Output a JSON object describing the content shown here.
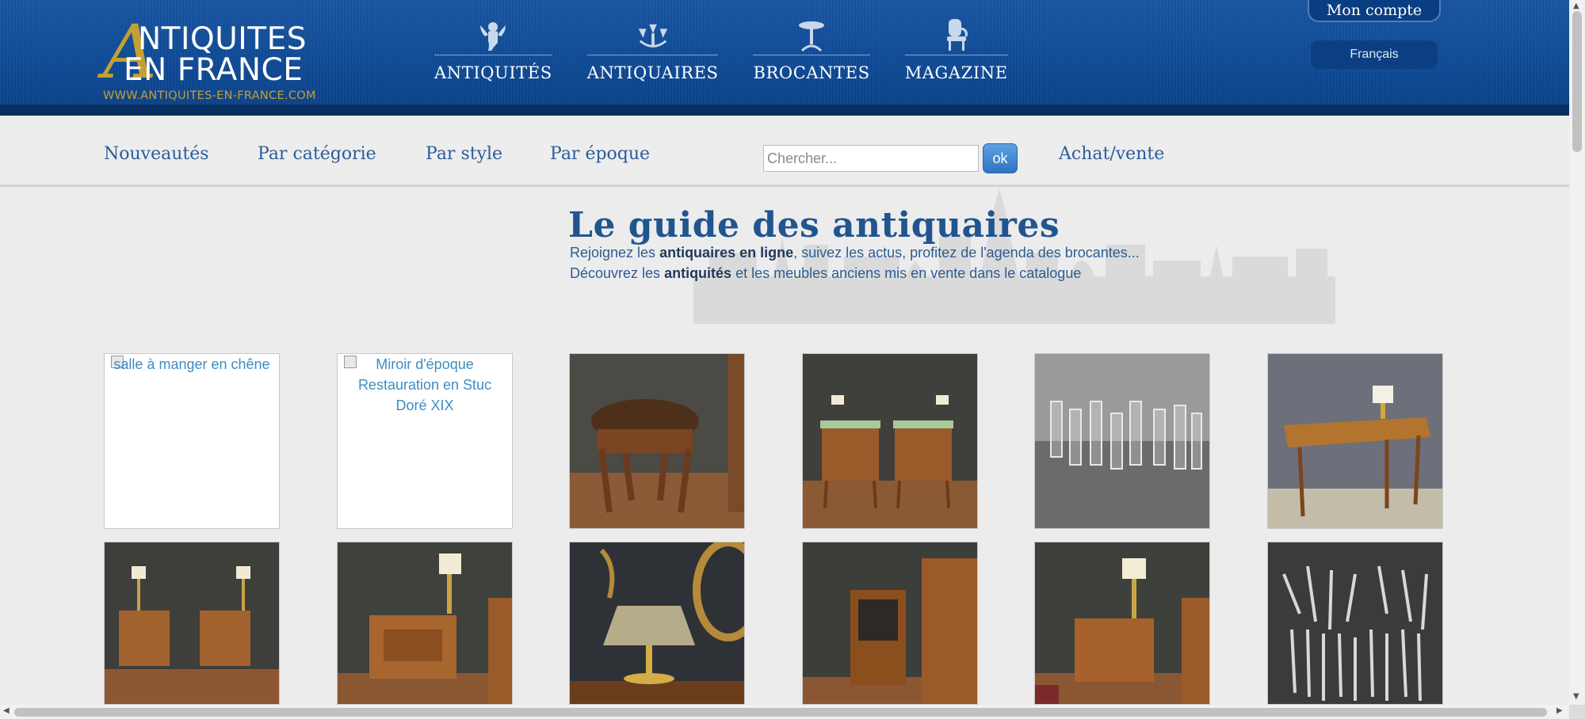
{
  "logo": {
    "letter": "A",
    "line1": "NTIQUITES",
    "line2": "EN FRANCE",
    "url": "WWW.ANTIQUITES-EN-FRANCE.COM"
  },
  "mainnav": [
    {
      "label": "ANTIQUITÉS",
      "icon": "cherub-icon"
    },
    {
      "label": "ANTIQUAIRES",
      "icon": "chandelier-icon"
    },
    {
      "label": "BROCANTES",
      "icon": "table-icon"
    },
    {
      "label": "MAGAZINE",
      "icon": "chair-icon"
    }
  ],
  "account": {
    "label": "Mon compte",
    "language": "Français"
  },
  "subnav": {
    "items": [
      "Nouveautés",
      "Par catégorie",
      "Par style",
      "Par époque"
    ],
    "search_placeholder": "Chercher...",
    "ok_label": "ok",
    "achat": "Achat/vente"
  },
  "guide": {
    "title": "Le guide des antiquaires",
    "line1_pre": "Rejoignez les ",
    "line1_bold": "antiquaires en ligne",
    "line1_post": ", suivez les actus, profitez de l'agenda des brocantes...",
    "line2_pre": "Découvrez les ",
    "line2_bold": "antiquités",
    "line2_post": " et les meubles anciens mis en vente dans le catalogue"
  },
  "thumbnails": {
    "broken1_alt": "salle à manger en chêne",
    "broken2_alt": "Miroir d'époque Restauration en Stuc Doré XIX"
  },
  "colors": {
    "header_blue": "#0f4a95",
    "nav_text": "#2a5d9a",
    "logo_gold": "#c4a033"
  }
}
